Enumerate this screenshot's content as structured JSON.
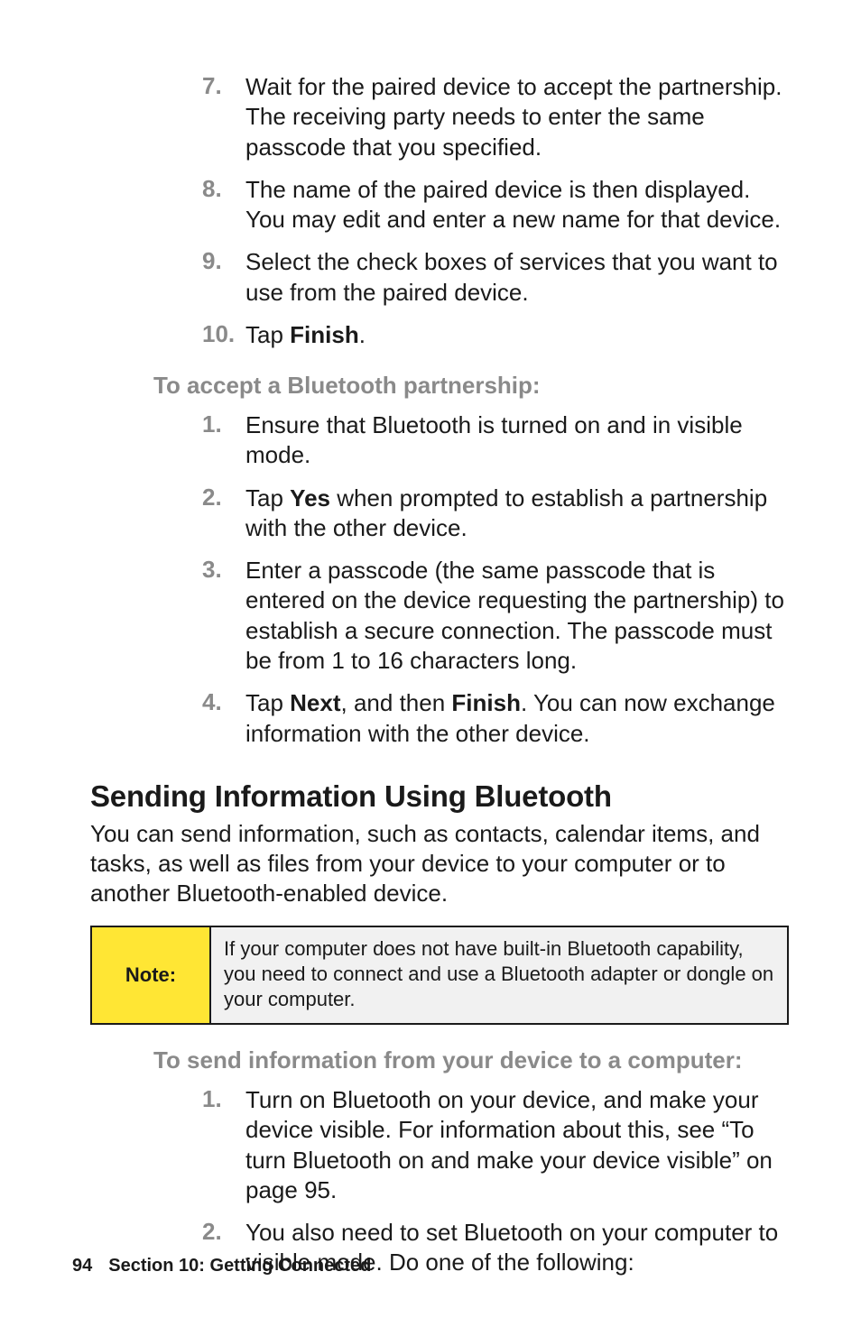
{
  "sectionA": {
    "items": [
      {
        "num": "7.",
        "text": "Wait for the paired device to accept the partnership. The receiving party needs to enter the same passcode that you specified."
      },
      {
        "num": "8.",
        "text": "The name of the paired device is then displayed.  You may edit and enter a new name for that device."
      },
      {
        "num": "9.",
        "text": "Select the check boxes of services that you want to use from the paired device."
      },
      {
        "num": "10.",
        "pre": "Tap ",
        "bold": "Finish",
        "post": "."
      }
    ]
  },
  "subheadA": "To accept a Bluetooth partnership:",
  "sectionB": {
    "items": [
      {
        "num": "1.",
        "text": "Ensure that Bluetooth is turned on and in visible mode."
      },
      {
        "num": "2.",
        "pre": "Tap ",
        "bold": "Yes",
        "post": " when prompted to establish a partnership with the other device."
      },
      {
        "num": "3.",
        "text": "Enter a passcode (the same passcode that is entered on the device requesting the partnership) to establish a secure connection. The passcode must be from 1 to 16 characters long."
      },
      {
        "num": "4.",
        "pre": "Tap ",
        "bold": "Next",
        "mid": ", and then ",
        "bold2": "Finish",
        "post": ". You can now exchange information with the other device."
      }
    ]
  },
  "h2": "Sending Information Using Bluetooth",
  "para": "You can send information, such as contacts, calendar items, and tasks, as well as files from your device to your computer or to another Bluetooth-enabled device.",
  "note": {
    "label": "Note:",
    "text": "If your computer does not have built-in Bluetooth capability, you need to connect and use a Bluetooth adapter or dongle on your computer."
  },
  "subheadB": "To send information from your device to a computer:",
  "sectionC": {
    "items": [
      {
        "num": "1.",
        "text": "Turn on Bluetooth on your device, and make your device visible. For information about this, see “To turn Bluetooth on and make your device visible” on page 95."
      },
      {
        "num": "2.",
        "text": "You also need to set Bluetooth on your computer to visible mode. Do one of the following:"
      }
    ]
  },
  "footer": {
    "pagenum": "94",
    "section": "Section 10: Getting Connected"
  }
}
